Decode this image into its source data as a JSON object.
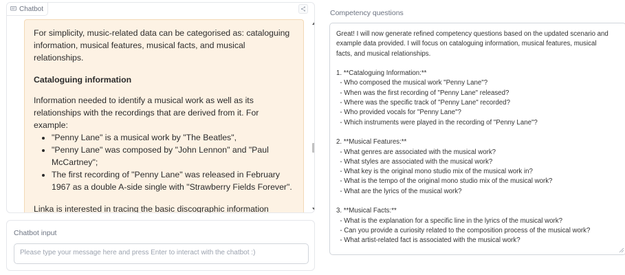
{
  "chatbot": {
    "label": "Chatbot",
    "message": {
      "intro": "For simplicity, music-related data can be categorised as: cataloguing information, musical features, musical facts, and musical relationships.",
      "heading": "Cataloguing information",
      "para1": "Information needed to identify a musical work as well as its relationships with the recordings that are derived from it. For example:",
      "bullets": [
        "\"Penny Lane\" is a musical work by \"The Beatles\",",
        "\"Penny Lane\" was composed by \"John Lennon\" and \"Paul McCartney\";",
        "The first recording of \"Penny Lane\" was released in February 1967 as a double A-side single with \"Strawberry Fields Forever\"."
      ],
      "para2": "Linka is interested in tracing the basic discographic information associated to the recordings of a certain musical work, including: the year of release, the name of the release, the place of recording, the instruments/performers relationships, and the vocals. Example data to"
    }
  },
  "chatbot_input": {
    "label": "Chatbot input",
    "placeholder": "Please type your message here and press Enter to interact with the chatbot :)",
    "value": ""
  },
  "competency_questions": {
    "label": "Competency questions",
    "lines": [
      "Great! I will now generate refined competency questions based on the updated scenario and",
      "example data provided. I will focus on cataloguing information, musical features, musical",
      "facts, and musical relationships.",
      "",
      "1. **Cataloguing Information:**",
      "  - Who composed the musical work \"Penny Lane\"?",
      "  - When was the first recording of \"Penny Lane\" released?",
      "  - Where was the specific track of \"Penny Lane\" recorded?",
      "  - Who provided vocals for \"Penny Lane\"?",
      "  - Which instruments were played in the recording of \"Penny Lane\"?",
      "",
      "2. **Musical Features:**",
      "  - What genres are associated with the musical work?",
      "  - What styles are associated with the musical work?",
      "  - What key is the original mono studio mix of the musical work in?",
      "  - What is the tempo of the original mono studio mix of the musical work?",
      "  - What are the lyrics of the musical work?",
      "",
      "3. **Musical Facts:**",
      "  - What is the explanation for a specific line in the lyrics of the musical work?",
      "  - Can you provide a curiosity related to the composition process of the musical work?",
      "  - What artist-related fact is associated with the musical work?"
    ]
  },
  "icons": {
    "chatbot": "chat-bubble-icon",
    "share": "share-icon",
    "resize": "resize-handle-icon"
  }
}
